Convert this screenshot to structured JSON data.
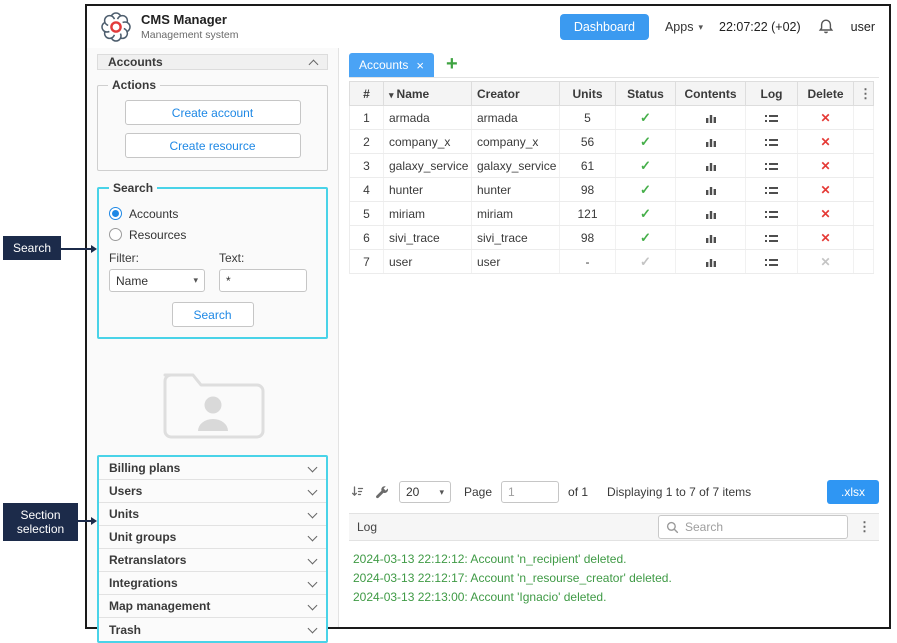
{
  "header": {
    "app_title": "CMS Manager",
    "app_subtitle": "Management system",
    "dashboard_button": "Dashboard",
    "apps_label": "Apps",
    "time": "22:07:22 (+02)",
    "user": "user"
  },
  "annotations": {
    "search_label": "Search",
    "section_label": "Section selection"
  },
  "sidebar": {
    "panel_title": "Accounts",
    "actions": {
      "legend": "Actions",
      "create_account": "Create account",
      "create_resource": "Create resource"
    },
    "search": {
      "legend": "Search",
      "radios": [
        {
          "label": "Accounts",
          "checked": true
        },
        {
          "label": "Resources",
          "checked": false
        }
      ],
      "filter_label": "Filter:",
      "text_label": "Text:",
      "filter_value": "Name",
      "text_value": "*",
      "button": "Search"
    },
    "sections": [
      "Billing plans",
      "Users",
      "Units",
      "Unit groups",
      "Retranslators",
      "Integrations",
      "Map management",
      "Trash"
    ]
  },
  "main": {
    "tab": "Accounts",
    "table": {
      "headers": [
        "#",
        "Name",
        "Creator",
        "Units",
        "Status",
        "Contents",
        "Log",
        "Delete"
      ],
      "rows": [
        {
          "num": "1",
          "name": "armada",
          "creator": "armada",
          "units": "5",
          "active": true
        },
        {
          "num": "2",
          "name": "company_x",
          "creator": "company_x",
          "units": "56",
          "active": true
        },
        {
          "num": "3",
          "name": "galaxy_service",
          "creator": "galaxy_service",
          "units": "61",
          "active": true
        },
        {
          "num": "4",
          "name": "hunter",
          "creator": "hunter",
          "units": "98",
          "active": true
        },
        {
          "num": "5",
          "name": "miriam",
          "creator": "miriam",
          "units": "121",
          "active": true
        },
        {
          "num": "6",
          "name": "sivi_trace",
          "creator": "sivi_trace",
          "units": "98",
          "active": true
        },
        {
          "num": "7",
          "name": "user",
          "creator": "user",
          "units": "-",
          "active": false
        }
      ]
    },
    "pagination": {
      "page_size": "20",
      "page_label": "Page",
      "page_value": "1",
      "of_label": "of 1",
      "displaying": "Displaying 1 to 7 of 7 items",
      "export_button": ".xlsx"
    },
    "log": {
      "title": "Log",
      "search_placeholder": "Search",
      "entries": [
        "2024-03-13 22:12:12: Account 'n_recipient' deleted.",
        "2024-03-13 22:12:17: Account 'n_resourse_creator' deleted.",
        "2024-03-13 22:13:00: Account 'Ignacio' deleted."
      ]
    }
  }
}
